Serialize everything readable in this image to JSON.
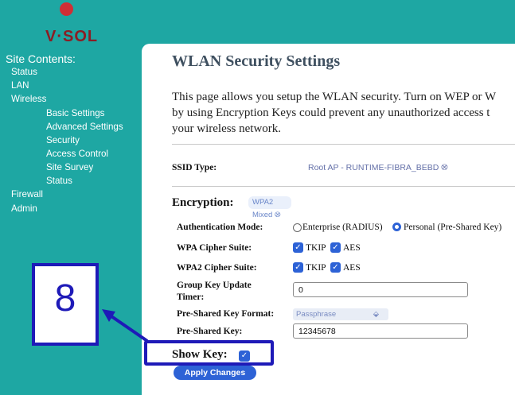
{
  "brand": {
    "logo_text": "V·SOL",
    "logo_color": "#8b1d24"
  },
  "sidebar": {
    "title": "Site Contents:",
    "items": [
      {
        "label": "Status"
      },
      {
        "label": "LAN"
      },
      {
        "label": "Wireless"
      },
      {
        "label": "Basic Settings"
      },
      {
        "label": "Advanced Settings"
      },
      {
        "label": "Security"
      },
      {
        "label": "Access Control"
      },
      {
        "label": "Site Survey"
      },
      {
        "label": "Status"
      },
      {
        "label": "Firewall"
      },
      {
        "label": "Admin"
      }
    ]
  },
  "page": {
    "title": "WLAN Security Settings",
    "intro_line1": "This page allows you setup the WLAN security. Turn on WEP or W",
    "intro_line2": "by using Encryption Keys could prevent any unauthorized access t",
    "intro_line3": "your wireless network."
  },
  "ssid": {
    "label": "SSID Type:",
    "value": "Root AP - RUNTIME-FIBRA_BEBD ⭙"
  },
  "encryption": {
    "label": "Encryption:",
    "value": "WPA2 Mixed ⭙",
    "auth_mode_label": "Authentication Mode:",
    "auth_enterprise": "Enterprise (RADIUS)",
    "auth_personal": "Personal (Pre-Shared Key)",
    "wpa_cipher_label": "WPA Cipher Suite:",
    "wpa2_cipher_label": "WPA2 Cipher Suite:",
    "tkip": "TKIP",
    "aes": "AES",
    "group_key_label_line1": "Group Key Update",
    "group_key_label_line2": "Timer:",
    "group_key_value": "0",
    "psk_format_label": "Pre-Shared Key Format:",
    "psk_format_value": "Passphrase",
    "psk_label": "Pre-Shared Key:",
    "psk_value": "12345678"
  },
  "show_key_label": "Show Key:",
  "apply_label": "Apply Changes",
  "annotation": {
    "number": "8",
    "color": "#1e1ab8"
  },
  "colors": {
    "accent": "#2d62d6",
    "sidebar_bg": "#1ea7a3"
  }
}
